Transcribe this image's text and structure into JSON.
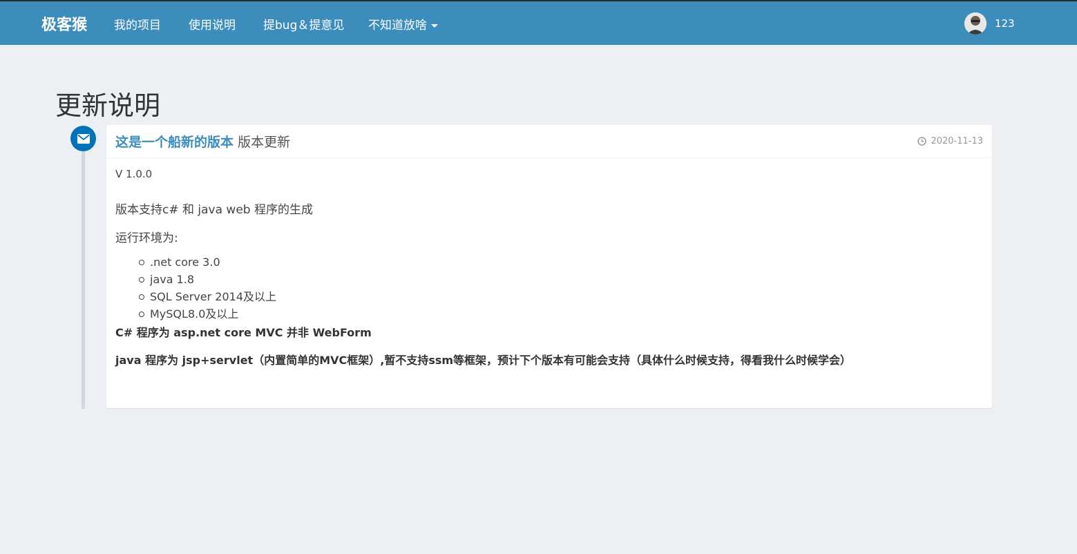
{
  "navbar": {
    "brand": "极客猴",
    "links": [
      "我的项目",
      "使用说明",
      "提bug＆提意见",
      "不知道放啥"
    ],
    "user_name": "123"
  },
  "page": {
    "title": "更新说明"
  },
  "timeline": {
    "icon": "envelope-icon",
    "title_link": "这是一个船新的版本",
    "title_suffix": "版本更新",
    "date": "2020-11-13",
    "version": "V 1.0.0",
    "support_text": "版本支持c# 和 java web 程序的生成",
    "env_label": "运行环境为:",
    "env_items": [
      ".net core 3.0",
      "java 1.8",
      "SQL Server 2014及以上",
      "MySQL8.0及以上"
    ],
    "csharp_note": "C# 程序为 asp.net core MVC 并非 WebForm",
    "java_note": "java 程序为 jsp+servlet（内置简单的MVC框架）,暂不支持ssm等框架，预计下个版本有可能会支持（具体什么时候支持，得看我什么时候学会）"
  },
  "colors": {
    "navbar": "#3c8dbc",
    "background": "#ecf0f5",
    "accent": "#0073b7",
    "timeline_bar": "#d2d6de"
  }
}
